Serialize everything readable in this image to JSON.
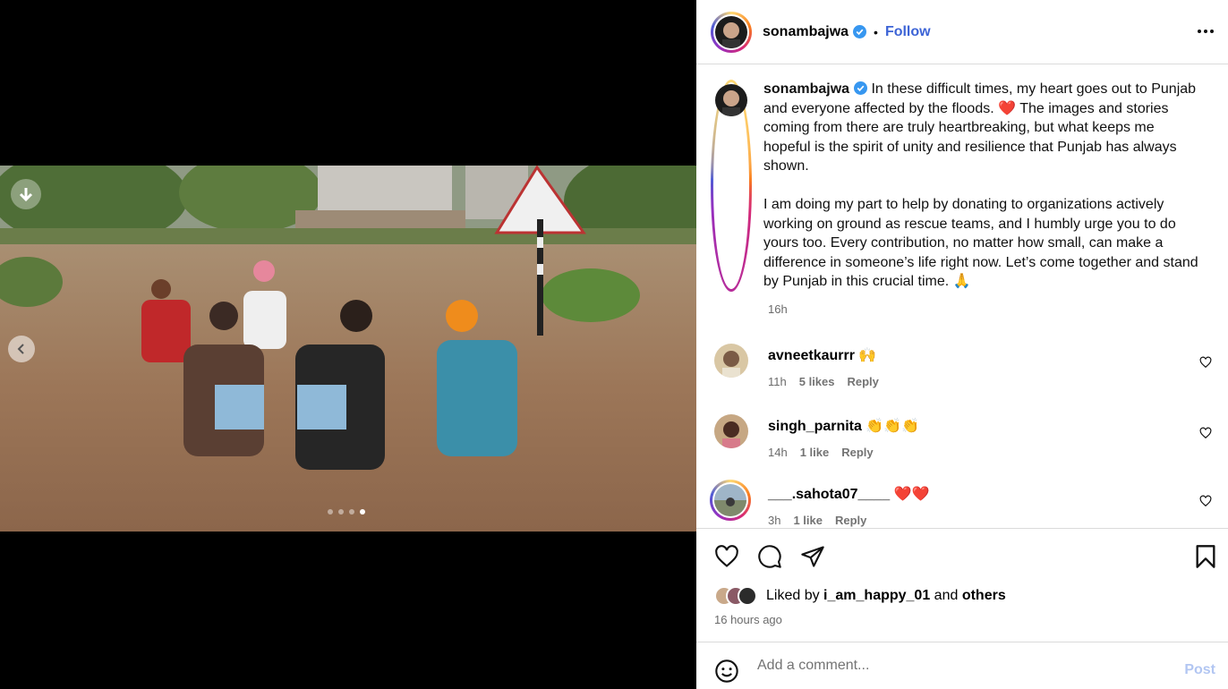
{
  "post": {
    "username": "sonambajwa",
    "follow_label": "Follow",
    "separator": "•",
    "more_icon": "more-horizontal-icon",
    "caption_part1": "In these difficult times, my heart goes out to Punjab and everyone affected by the floods. ",
    "caption_emoji1": "❤️",
    "caption_part2": " The images and stories coming from there are truly heartbreaking, but what keeps me hopeful is the spirit of unity and resilience that Punjab has always shown.\n\nI am doing my part to help by donating to organizations actively working on ground as rescue teams, and I humbly urge you to do yours too. Every contribution, no matter how small, can make a difference in someone’s life right now. Let’s come together and stand by Punjab in this crucial time. ",
    "caption_emoji2": "🙏",
    "caption_time": "16h"
  },
  "carousel": {
    "current_index": 4,
    "total": 4
  },
  "comments": [
    {
      "username": "avneetkaurrr",
      "text": "🙌",
      "time": "11h",
      "likes": "5 likes",
      "reply": "Reply"
    },
    {
      "username": "singh_parnita",
      "text": "👏👏👏",
      "time": "14h",
      "likes": "1 like",
      "reply": "Reply"
    },
    {
      "username": "___.sahota07____",
      "text": "❤️❤️",
      "time": "3h",
      "likes": "1 like",
      "reply": "Reply"
    }
  ],
  "actions": {
    "liked_by_prefix": "Liked by ",
    "liked_by_user": "i_am_happy_01",
    "liked_by_and": " and ",
    "liked_by_others": "others",
    "posted_ago": "16 hours ago"
  },
  "add_comment": {
    "placeholder": "Add a comment...",
    "post_label": "Post"
  },
  "colors": {
    "accent": "#3d64d6",
    "post_disabled": "#b2c6f2",
    "verified": "#3797f0",
    "heart_red": "#e0242f"
  }
}
